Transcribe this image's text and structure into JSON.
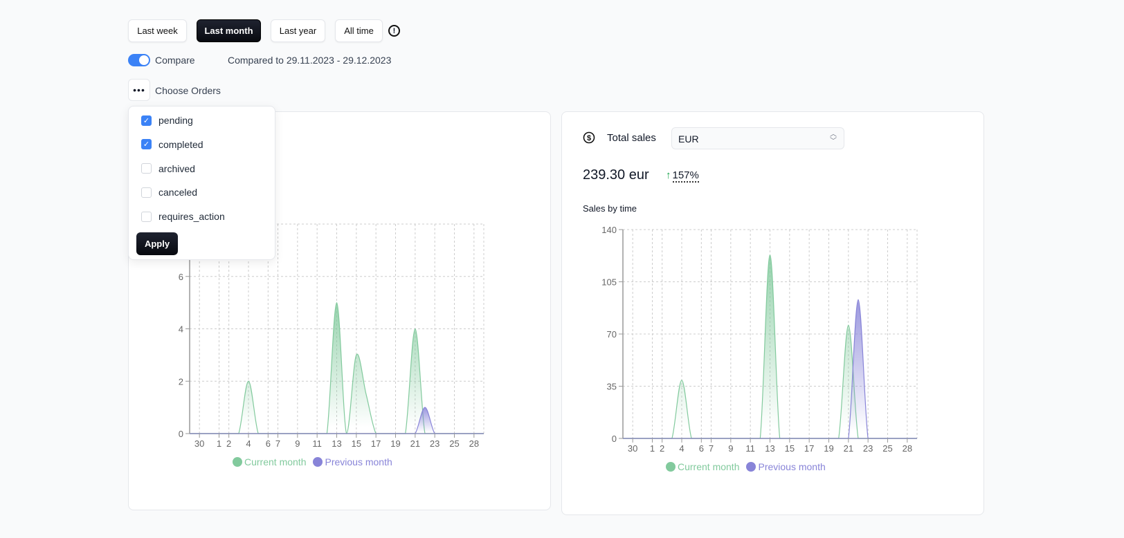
{
  "filters": {
    "ranges": [
      {
        "label": "Last week",
        "active": false
      },
      {
        "label": "Last month",
        "active": true
      },
      {
        "label": "Last year",
        "active": false
      },
      {
        "label": "All time",
        "active": false
      }
    ],
    "info_icon": "exclamation-circle-icon"
  },
  "compare": {
    "label": "Compare",
    "enabled": true,
    "range_text": "Compared to 29.11.2023 - 29.12.2023"
  },
  "orders": {
    "button_icon": "more-icon",
    "label": "Choose Orders",
    "options": [
      {
        "label": "pending",
        "checked": true
      },
      {
        "label": "completed",
        "checked": true
      },
      {
        "label": "archived",
        "checked": false
      },
      {
        "label": "canceled",
        "checked": false
      },
      {
        "label": "requires_action",
        "checked": false
      }
    ],
    "apply_label": "Apply"
  },
  "sales": {
    "icon": "dollar-circle-icon",
    "title": "Total sales",
    "currency": "EUR",
    "total": "239.30 eur",
    "change": "157%",
    "change_direction": "up",
    "change_color": "#16a34a",
    "chart_title": "Sales by time"
  },
  "colors": {
    "current": "#82ca9d",
    "previous": "#8884d8"
  },
  "chart_data": [
    {
      "type": "area",
      "title": "",
      "x_ticks": [
        {
          "label": "30",
          "index": 1
        },
        {
          "label": "1",
          "index": 3
        },
        {
          "label": "2",
          "index": 4
        },
        {
          "label": "4",
          "index": 6
        },
        {
          "label": "6",
          "index": 8
        },
        {
          "label": "7",
          "index": 9
        },
        {
          "label": "9",
          "index": 11
        },
        {
          "label": "11",
          "index": 13
        },
        {
          "label": "13",
          "index": 15
        },
        {
          "label": "15",
          "index": 17
        },
        {
          "label": "17",
          "index": 19
        },
        {
          "label": "19",
          "index": 21
        },
        {
          "label": "21",
          "index": 23
        },
        {
          "label": "23",
          "index": 25
        },
        {
          "label": "25",
          "index": 27
        },
        {
          "label": "28",
          "index": 29
        }
      ],
      "points": 31,
      "ylim": [
        0,
        8
      ],
      "y_ticks": [
        "0",
        "2",
        "4",
        "6"
      ],
      "grid": true,
      "legend": "bottom",
      "series": [
        {
          "name": "Current month",
          "values": [
            0,
            0,
            0,
            0,
            0,
            0,
            2,
            0,
            0,
            0,
            0,
            0,
            0,
            0,
            0,
            5,
            0,
            3,
            1.5,
            0,
            0,
            0,
            0,
            4,
            0,
            0,
            0,
            0,
            0,
            0,
            0
          ]
        },
        {
          "name": "Previous month",
          "values": [
            0,
            0,
            0,
            0,
            0,
            0,
            0,
            0,
            0,
            0,
            0,
            0,
            0,
            0,
            0,
            0,
            0,
            0,
            0,
            0,
            0,
            0,
            0,
            0,
            1,
            0,
            0,
            0,
            0,
            0,
            0
          ]
        }
      ]
    },
    {
      "type": "area",
      "title": "Sales by time",
      "x_ticks": [
        {
          "label": "30",
          "index": 1
        },
        {
          "label": "1",
          "index": 3
        },
        {
          "label": "2",
          "index": 4
        },
        {
          "label": "4",
          "index": 6
        },
        {
          "label": "6",
          "index": 8
        },
        {
          "label": "7",
          "index": 9
        },
        {
          "label": "9",
          "index": 11
        },
        {
          "label": "11",
          "index": 13
        },
        {
          "label": "13",
          "index": 15
        },
        {
          "label": "15",
          "index": 17
        },
        {
          "label": "17",
          "index": 19
        },
        {
          "label": "19",
          "index": 21
        },
        {
          "label": "21",
          "index": 23
        },
        {
          "label": "23",
          "index": 25
        },
        {
          "label": "25",
          "index": 27
        },
        {
          "label": "28",
          "index": 29
        }
      ],
      "points": 31,
      "ylim": [
        0,
        140
      ],
      "y_ticks": [
        "0",
        "35",
        "70",
        "105",
        "140"
      ],
      "grid": true,
      "legend": "bottom",
      "series": [
        {
          "name": "Current month",
          "values": [
            0,
            0,
            0,
            0,
            0,
            0,
            39,
            0,
            0,
            0,
            0,
            0,
            0,
            0,
            0,
            123,
            0,
            0,
            0,
            0,
            0,
            0,
            0,
            76,
            0,
            0,
            0,
            0,
            0,
            0,
            0
          ]
        },
        {
          "name": "Previous month",
          "values": [
            0,
            0,
            0,
            0,
            0,
            0,
            0,
            0,
            0,
            0,
            0,
            0,
            0,
            0,
            0,
            0,
            0,
            0,
            0,
            0,
            0,
            0,
            0,
            0,
            93,
            0,
            0,
            0,
            0,
            0,
            0
          ]
        }
      ]
    }
  ]
}
